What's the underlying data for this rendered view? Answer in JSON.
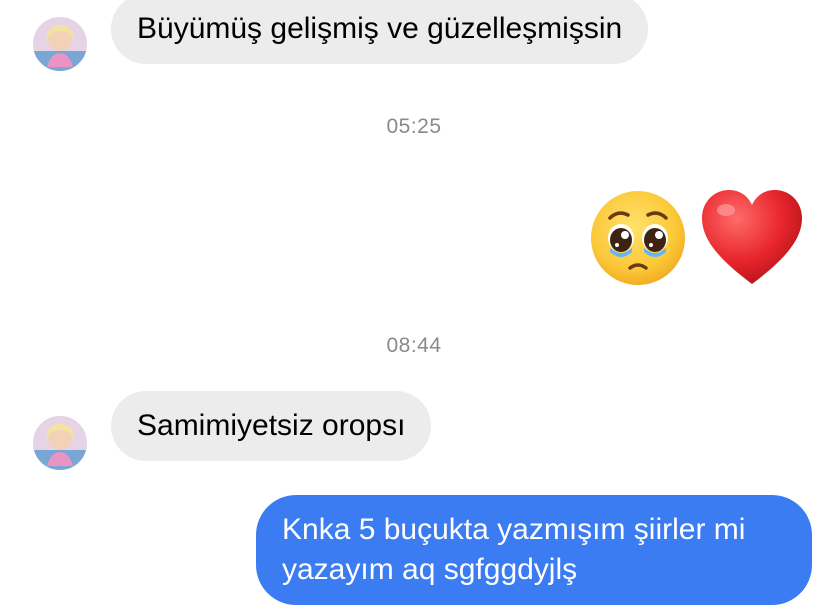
{
  "messages": [
    {
      "direction": "incoming",
      "text": "Büyümüş gelişmiş ve güzelleşmişsin"
    },
    {
      "direction": "timestamp",
      "text": "05:25"
    },
    {
      "direction": "outgoing",
      "emojis": [
        "pleading-face-emoji",
        "red-heart-emoji"
      ]
    },
    {
      "direction": "timestamp",
      "text": "08:44"
    },
    {
      "direction": "incoming",
      "text": "Samimiyetsiz oropsı"
    },
    {
      "direction": "outgoing",
      "text": "Knka 5 buçukta yazmışım şiirler mi yazayım aq sgfggdyjlş"
    }
  ],
  "colors": {
    "incoming_bubble": "#ececec",
    "outgoing_bubble": "#3b7cf3",
    "timestamp_text": "#8a8a8e"
  }
}
